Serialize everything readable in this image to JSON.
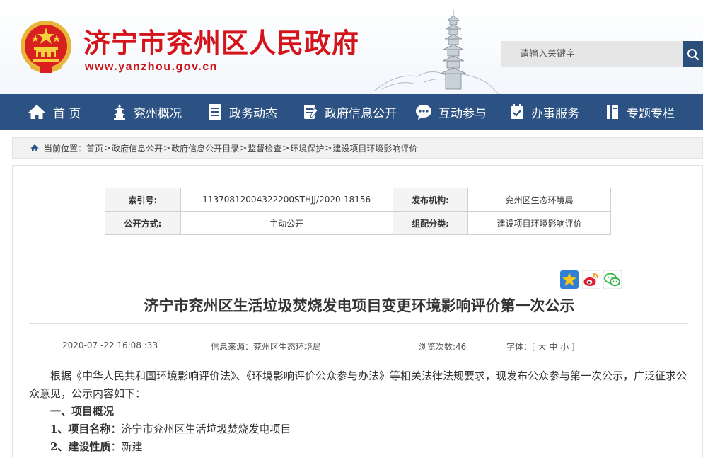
{
  "header": {
    "site_title": "济宁市兖州区人民政府",
    "site_url": "www.yanzhou.gov.cn",
    "search_placeholder": "请输入关键字"
  },
  "nav": {
    "items": [
      {
        "label": "首 页",
        "icon": "home-icon"
      },
      {
        "label": "兖州概况",
        "icon": "pagoda-icon"
      },
      {
        "label": "政务动态",
        "icon": "document-list-icon"
      },
      {
        "label": "政府信息公开",
        "icon": "notebook-pen-icon"
      },
      {
        "label": "互动参与",
        "icon": "chat-bubble-icon"
      },
      {
        "label": "办事服务",
        "icon": "calendar-check-icon"
      },
      {
        "label": "专题专栏",
        "icon": "book-icon"
      }
    ]
  },
  "breadcrumb": {
    "prefix": "当前位置：",
    "items": [
      "首页",
      "政府信息公开",
      "政府信息公开目录",
      "监督检查",
      "环境保护",
      "建设项目环境影响评价"
    ]
  },
  "info_table": {
    "index_label": "索引号:",
    "index_value": "11370812004322200STHJJ/2020-18156",
    "publisher_label": "发布机构:",
    "publisher_value": "兖州区生态环境局",
    "open_mode_label": "公开方式:",
    "open_mode_value": "主动公开",
    "category_label": "组配分类:",
    "category_value": "建设项目环境影响评价"
  },
  "share_icons": [
    "qzone-share-icon",
    "weibo-share-icon",
    "wechat-share-icon"
  ],
  "article": {
    "title": "济宁市兖州区生活垃圾焚烧发电项目变更环境影响评价第一次公示",
    "date": "2020-07 -22 16:08 :33",
    "source": "信息来源：兖州区生态环境局",
    "views": "浏览次数:46",
    "font_label": "字体：[",
    "font_large": "大",
    "font_medium": "中",
    "font_small": "小",
    "font_end": "]",
    "para1": "根据《中华人民共和国环境影响评价法》、《环境影响评价公众参与办法》等相关法律法规要求，现发布公众参与第一次公示，广泛征求公众意见，公示内容如下：",
    "section1": "一、项目概况",
    "item1_label": "1、项目名称",
    "item1_value": "：济宁市兖州区生活垃圾焚烧发电项目",
    "item2_label": "2、建设性质",
    "item2_value": "：新建"
  },
  "colors": {
    "brand_red": "#d3141b",
    "nav_blue": "#2c5183",
    "search_button": "#2a4f7a"
  }
}
